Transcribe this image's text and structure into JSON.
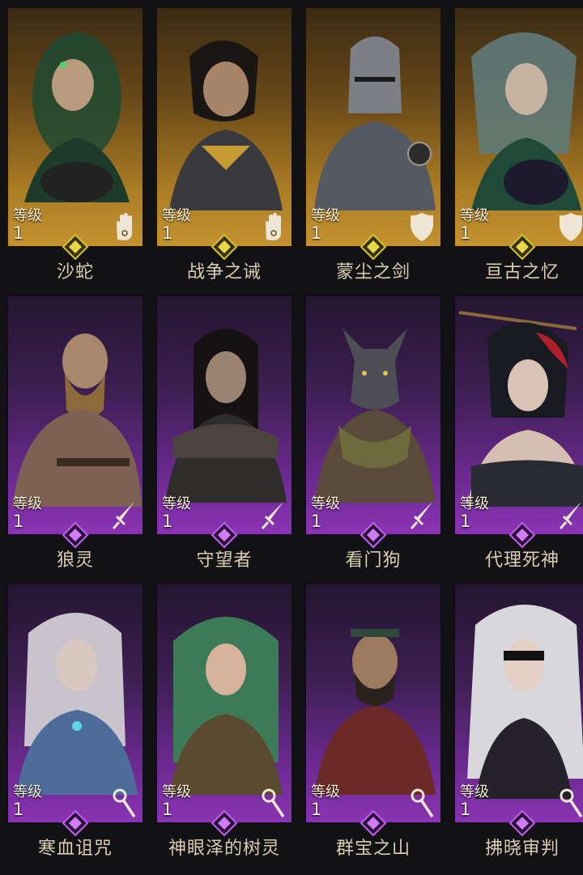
{
  "level_label": "等级",
  "colors": {
    "gold_frame": "#a97b24",
    "purple_frame": "#6e2a93",
    "name_text": "#d9cdb4",
    "background": "#121113"
  },
  "heroes": [
    {
      "name": "沙蛇",
      "level": "1",
      "rarity": "gold",
      "role_icon": "hand-icon"
    },
    {
      "name": "战争之诫",
      "level": "1",
      "rarity": "gold",
      "role_icon": "hand-icon"
    },
    {
      "name": "蒙尘之剑",
      "level": "1",
      "rarity": "gold",
      "role_icon": "shield-icon"
    },
    {
      "name": "亘古之忆",
      "level": "1",
      "rarity": "gold",
      "role_icon": "shield-icon"
    },
    {
      "name": "狼灵",
      "level": "1",
      "rarity": "purple",
      "role_icon": "sword-icon"
    },
    {
      "name": "守望者",
      "level": "1",
      "rarity": "purple",
      "role_icon": "sword-icon"
    },
    {
      "name": "看门狗",
      "level": "1",
      "rarity": "purple",
      "role_icon": "sword-icon"
    },
    {
      "name": "代理死神",
      "level": "1",
      "rarity": "purple",
      "role_icon": "sword-icon"
    },
    {
      "name": "寒血诅咒",
      "level": "1",
      "rarity": "purple",
      "role_icon": "staff-icon"
    },
    {
      "name": "神眼泽的树灵",
      "level": "1",
      "rarity": "purple",
      "role_icon": "staff-icon"
    },
    {
      "name": "群宝之山",
      "level": "1",
      "rarity": "purple",
      "role_icon": "staff-icon"
    },
    {
      "name": "拂晓审判",
      "level": "1",
      "rarity": "purple",
      "role_icon": "staff-icon"
    }
  ]
}
